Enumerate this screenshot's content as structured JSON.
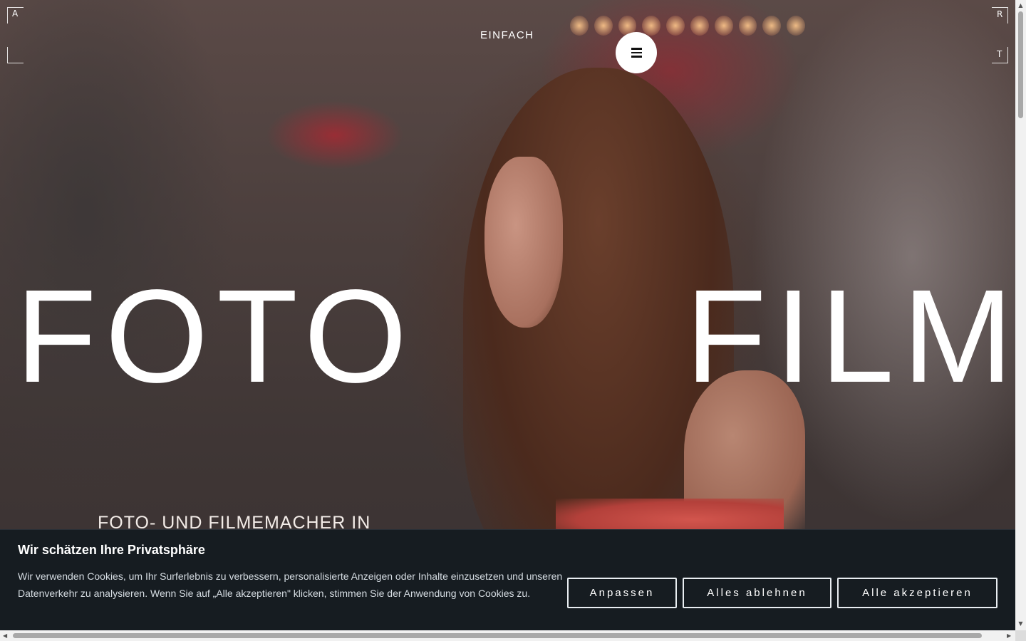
{
  "header": {
    "brand": "EINFACH",
    "corner_letters": {
      "top_left": "A",
      "top_right": "R",
      "bottom_right": "T"
    },
    "menu_icon": "hamburger-icon"
  },
  "hero": {
    "word_left": "FOTO",
    "word_right": "FILM",
    "tagline": "FOTO- UND FILMEMACHER IN"
  },
  "cookie_banner": {
    "title": "Wir schätzen Ihre Privatsphäre",
    "text": "Wir verwenden Cookies, um Ihr Surferlebnis zu verbessern, personalisierte Anzeigen oder Inhalte einzusetzen und unseren Datenverkehr zu analysieren. Wenn Sie auf „Alle akzeptieren\" klicken, stimmen Sie der Anwendung von Cookies zu.",
    "buttons": {
      "customize": "Anpassen",
      "reject_all": "Alles ablehnen",
      "accept_all": "Alle akzeptieren"
    },
    "background_color": "#161c21"
  },
  "scrollbars": {
    "up_arrow": "▲",
    "down_arrow": "▼",
    "left_arrow": "◀",
    "right_arrow": "▶"
  }
}
